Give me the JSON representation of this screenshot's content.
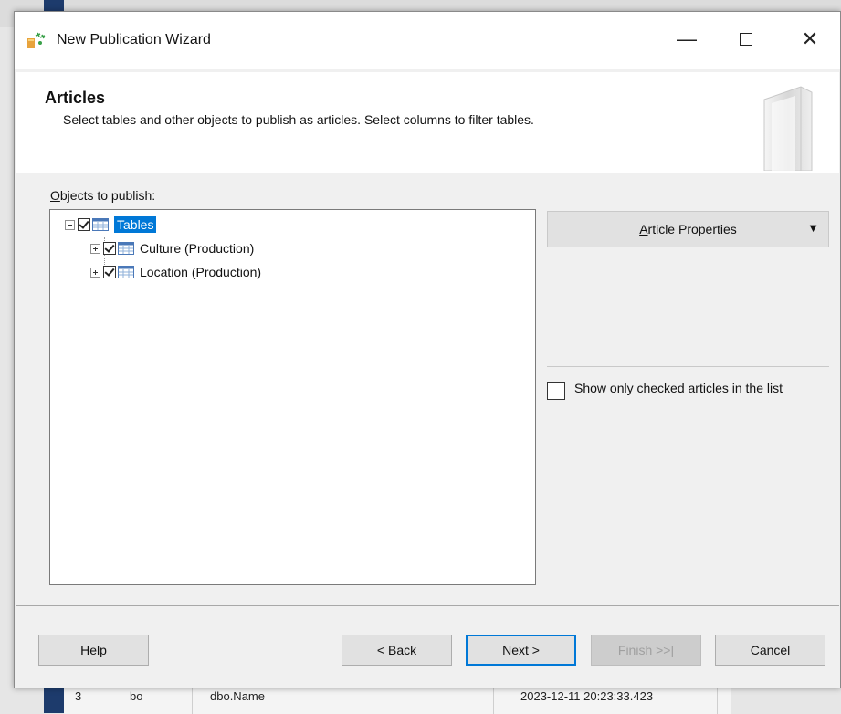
{
  "window": {
    "title": "New Publication Wizard",
    "minimize_glyph": "—",
    "close_glyph": "✕"
  },
  "header": {
    "title": "Articles",
    "description": "Select tables and other objects to publish as articles. Select columns to filter tables."
  },
  "objects": {
    "label_mnemonic": "O",
    "label_rest": "bjects to publish:",
    "tree": {
      "root": {
        "label": "Tables",
        "checked": true,
        "expanded": true,
        "selected": true
      },
      "children": [
        {
          "label": "Culture (Production)",
          "checked": true
        },
        {
          "label": "Location (Production)",
          "checked": true
        }
      ]
    }
  },
  "article_properties": {
    "mnemonic": "A",
    "rest": "rticle Properties",
    "arrow": "▼"
  },
  "show_only_checked": {
    "mnemonic": "S",
    "rest": "how only checked articles in the list",
    "checked": false
  },
  "buttons": {
    "help": {
      "mnemonic": "H",
      "rest": "elp"
    },
    "back": {
      "prefix": "< ",
      "mnemonic": "B",
      "rest": "ack"
    },
    "next": {
      "mnemonic": "N",
      "rest": "ext >"
    },
    "finish": {
      "mnemonic": "F",
      "rest": "inish >>|",
      "enabled": false
    },
    "cancel": {
      "label": "Cancel"
    }
  },
  "background_row": {
    "col1": "3",
    "col2": "bo",
    "col3": "dbo.Name",
    "col4": "2023-12-11 20:23:33.423"
  },
  "colors": {
    "selection": "#0078d7",
    "default_button_border": "#0078d7"
  }
}
